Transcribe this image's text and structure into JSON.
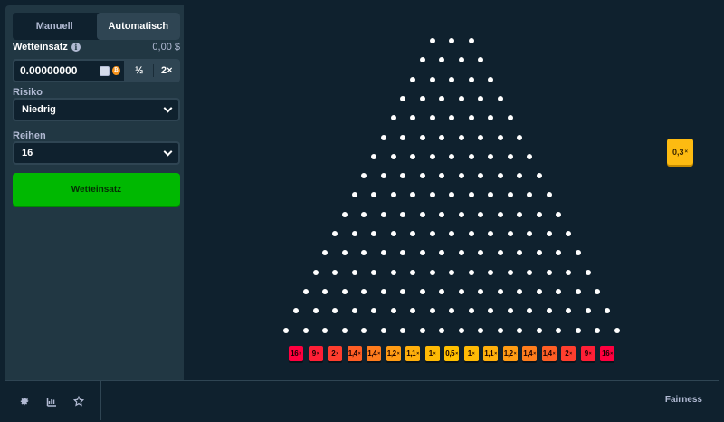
{
  "tabs": [
    {
      "label": "Manuell",
      "active": false
    },
    {
      "label": "Automatisch",
      "active": true
    }
  ],
  "bet": {
    "label": "Wetteinsatz",
    "amount_usd": "0,00 $",
    "value": "0.00000000",
    "half_label": "½",
    "double_label": "2×"
  },
  "risk": {
    "label": "Risiko",
    "value": "Niedrig"
  },
  "rows": {
    "label": "Reihen",
    "value": "16"
  },
  "bet_button_label": "Wetteinsatz",
  "multipliers": [
    "16",
    "9",
    "2",
    "1,4",
    "1,4",
    "1,2",
    "1,1",
    "1",
    "0,5",
    "1",
    "1,1",
    "1,2",
    "1,4",
    "1,4",
    "2",
    "9",
    "16"
  ],
  "multiplier_suffix": "×",
  "slot_colors": [
    "#ff003f",
    "#ff1f36",
    "#ff3e2e",
    "#ff5e25",
    "#ff7d1d",
    "#ff9c14",
    "#ffb00c",
    "#ffbb05",
    "#ffc000",
    "#ffbb05",
    "#ffb00c",
    "#ff9c14",
    "#ff7d1d",
    "#ff5e25",
    "#ff3e2e",
    "#ff1f36",
    "#ff003f"
  ],
  "last_result": "0,3",
  "footer": {
    "icons": [
      "gear-icon",
      "chart-icon",
      "star-icon"
    ],
    "fairness_label": "Fairness"
  },
  "colors": {
    "accent_green": "#00b801",
    "panel": "#213743",
    "background": "#0f212e",
    "last_result": "#fdbb11"
  }
}
